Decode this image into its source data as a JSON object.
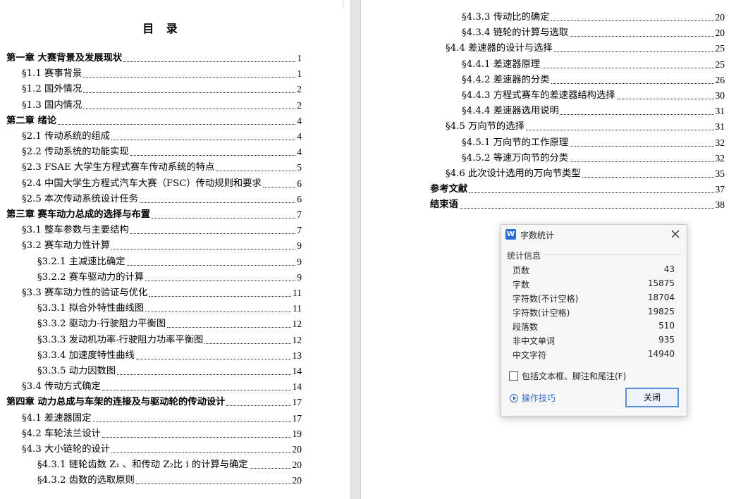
{
  "left_page": {
    "title": "目 录",
    "entries": [
      {
        "level": 1,
        "text": "第一章 大赛背景及发展现状",
        "page": "1"
      },
      {
        "level": 2,
        "text": "§1.1 赛事背景",
        "page": "1"
      },
      {
        "level": 2,
        "text": "§1.2 国外情况",
        "page": "2"
      },
      {
        "level": 2,
        "text": "§1.3 国内情况",
        "page": "2"
      },
      {
        "level": 1,
        "text": "第二章 绪论",
        "page": "4"
      },
      {
        "level": 2,
        "text": "§2.1 传动系统的组成",
        "page": "4"
      },
      {
        "level": 2,
        "text": "§2.2 传动系统的功能实现",
        "page": "4"
      },
      {
        "level": 2,
        "text": "§2.3 FSAE 大学生方程式赛车传动系统的特点",
        "page": "5"
      },
      {
        "level": 2,
        "text": "§2.4 中国大学生方程式汽车大赛（FSC）传动规则和要求",
        "page": "6"
      },
      {
        "level": 2,
        "text": "§2.5 本次传动系统设计任务",
        "page": "6"
      },
      {
        "level": 1,
        "text": "第三章 赛车动力总成的选择与布置",
        "page": "7"
      },
      {
        "level": 2,
        "text": "§3.1 整车参数与主要结构",
        "page": "7"
      },
      {
        "level": 2,
        "text": "§3.2 赛车动力性计算",
        "page": "9"
      },
      {
        "level": 3,
        "text": "§3.2.1 主减速比确定",
        "page": "9"
      },
      {
        "level": 3,
        "text": "§3.2.2 赛车驱动力的计算",
        "page": "9"
      },
      {
        "level": 2,
        "text": "§3.3 赛车动力性的验证与优化",
        "page": "11"
      },
      {
        "level": 3,
        "text": "§3.3.1 拟合外特性曲线图",
        "page": "11"
      },
      {
        "level": 3,
        "text": "§3.3.2 驱动力-行驶阻力平衡图",
        "page": "12"
      },
      {
        "level": 3,
        "text": "§3.3.3 发动机功率-行驶阻力功率平衡图",
        "page": "12"
      },
      {
        "level": 3,
        "text": "§3.3.4 加速度特性曲线",
        "page": "13"
      },
      {
        "level": 3,
        "text": "§3.3.5 动力因数图",
        "page": "14"
      },
      {
        "level": 2,
        "text": "§3.4 传动方式确定",
        "page": "14"
      },
      {
        "level": 1,
        "text": "第四章 动力总成与车架的连接及与驱动轮的传动设计",
        "page": "17"
      },
      {
        "level": 2,
        "text": "§4.1 差速器固定",
        "page": "17"
      },
      {
        "level": 2,
        "text": "§4.2 车轮法兰设计",
        "page": "19"
      },
      {
        "level": 2,
        "text": "§4.3 大小链轮的设计",
        "page": "20"
      },
      {
        "level": 3,
        "text": "§4.3.1 链轮齿数 Z₁ 、和传动 Z₂比 i 的计算与确定",
        "page": "20"
      },
      {
        "level": 3,
        "text": "§4.3.2 齿数的选取原则",
        "page": "20"
      }
    ]
  },
  "right_page": {
    "entries": [
      {
        "level": 3,
        "text": "§4.3.3 传动比的确定",
        "page": "20"
      },
      {
        "level": 3,
        "text": "§4.3.4 链轮的计算与选取",
        "page": "20"
      },
      {
        "level": 2,
        "text": "§4.4 差速器的设计与选择",
        "page": "25"
      },
      {
        "level": 3,
        "text": "§4.4.1 差速器原理",
        "page": "25"
      },
      {
        "level": 3,
        "text": "§4.4.2 差速器的分类",
        "page": "26"
      },
      {
        "level": 3,
        "text": "§4.4.3 方程式赛车的差速器结构选择",
        "page": "30"
      },
      {
        "level": 3,
        "text": "§4.4.4 差速器选用说明",
        "page": "31"
      },
      {
        "level": 2,
        "text": "§4.5 万向节的选择",
        "page": "31"
      },
      {
        "level": 3,
        "text": "§4.5.1 万向节的工作原理",
        "page": "32"
      },
      {
        "level": 3,
        "text": "§4.5.2 等速万向节的分类",
        "page": "32"
      },
      {
        "level": 2,
        "text": "§4.6 此次设计选用的万向节类型",
        "page": "35"
      },
      {
        "level": 1,
        "text": "参考文献",
        "page": "37"
      },
      {
        "level": 1,
        "text": "结束语",
        "page": "38"
      }
    ]
  },
  "dialog": {
    "app_icon": "W",
    "title": "字数统计",
    "group_label": "统计信息",
    "stats": [
      {
        "label": "页数",
        "value": "43"
      },
      {
        "label": "字数",
        "value": "15875"
      },
      {
        "label": "字符数(不计空格)",
        "value": "18704"
      },
      {
        "label": "字符数(计空格)",
        "value": "19825"
      },
      {
        "label": "段落数",
        "value": "510"
      },
      {
        "label": "非中文单词",
        "value": "935"
      },
      {
        "label": "中文字符",
        "value": "14940"
      }
    ],
    "include_label": "包括文本框、脚注和尾注(F)",
    "include_checked": false,
    "tips_label": "操作技巧",
    "close_label": "关闭",
    "accent_color": "#2d6cc8"
  }
}
